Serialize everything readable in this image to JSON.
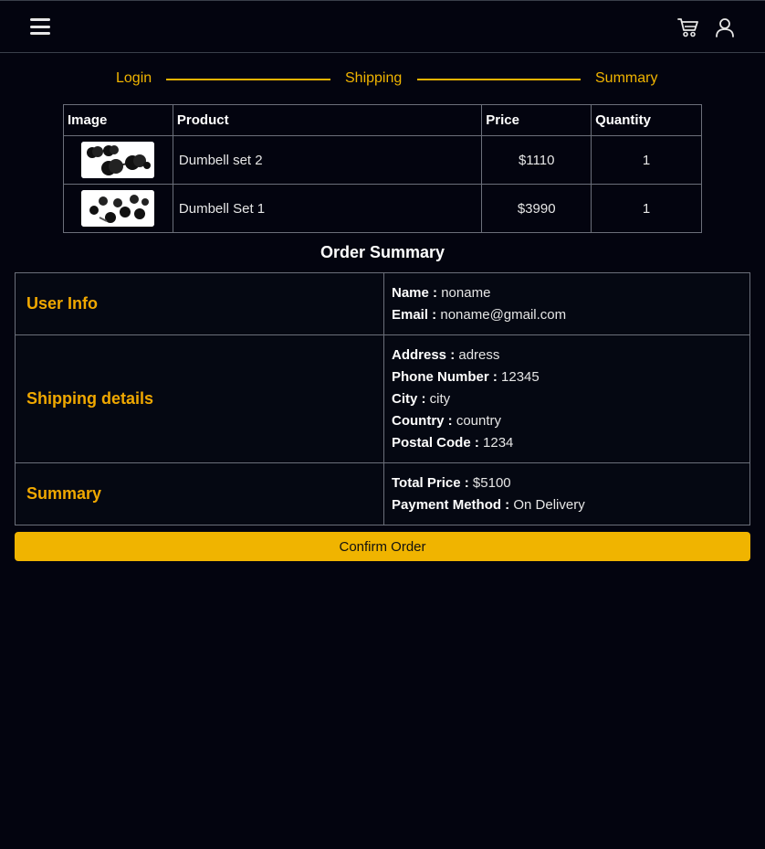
{
  "header": {
    "menu_icon": "hamburger-menu-icon",
    "cart_icon": "cart-icon",
    "user_icon": "user-icon"
  },
  "steps": [
    "Login",
    "Shipping",
    "Summary"
  ],
  "products_table": {
    "headers": [
      "Image",
      "Product",
      "Price",
      "Quantity"
    ],
    "rows": [
      {
        "image": "dumbbell-set-2-image",
        "product": "Dumbell set 2",
        "price": "$1110",
        "quantity": "1"
      },
      {
        "image": "dumbbell-set-1-image",
        "product": "Dumbell Set 1",
        "price": "$3990",
        "quantity": "1"
      }
    ]
  },
  "order_summary": {
    "title": "Order Summary",
    "user_info": {
      "heading": "User Info",
      "name_label": "Name :",
      "name": "noname",
      "email_label": "Email :",
      "email": "noname@gmail.com"
    },
    "shipping": {
      "heading": "Shipping details",
      "address_label": "Address :",
      "address": "adress",
      "phone_label": "Phone Number :",
      "phone": "12345",
      "city_label": "City :",
      "city": "city",
      "country_label": "Country :",
      "country": "country",
      "postal_label": "Postal Code :",
      "postal": "1234"
    },
    "summary": {
      "heading": "Summary",
      "total_label": "Total Price :",
      "total": "$5100",
      "payment_label": "Payment Method :",
      "payment": "On Delivery"
    }
  },
  "confirm_button": "Confirm Order",
  "colors": {
    "background": "#03040f",
    "accent": "#f0b400",
    "border": "#6b6f7a"
  }
}
